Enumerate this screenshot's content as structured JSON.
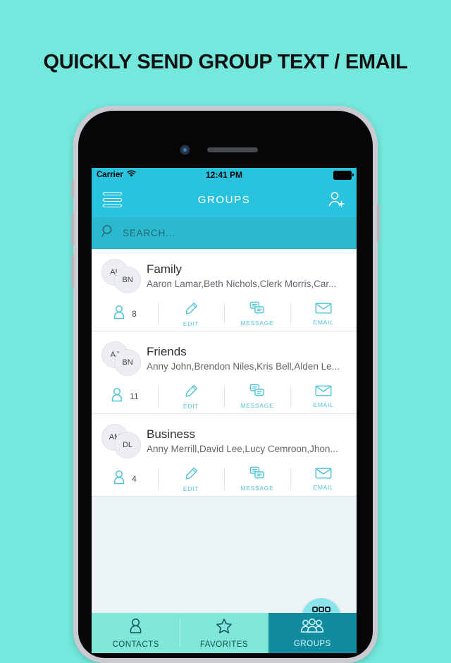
{
  "headline": "QUICKLY SEND GROUP TEXT / EMAIL",
  "colors": {
    "page_background": "#74e8dd",
    "nav_accent": "#2ac3dd",
    "search_background": "#2ab9cf",
    "action_icon": "#4fc3d9",
    "tab_inactive": "#7fe8d8",
    "tab_active": "#118b9e",
    "fab_background": "#8ee4ec",
    "screen_background": "#ecf4f6"
  },
  "status_bar": {
    "carrier": "Carrier",
    "wifi_icon": "wifi-icon",
    "time": "12:41 PM",
    "battery_icon": "battery-full-icon"
  },
  "nav": {
    "menu_icon": "hamburger-menu-icon",
    "title": "GROUPS",
    "add_icon": "add-person-icon"
  },
  "search": {
    "icon": "search-icon",
    "placeholder": "SEARCH..."
  },
  "groups": [
    {
      "name": "Family",
      "members": "Aaron Lamar,Beth Nichols,Clerk Morris,Car...",
      "avatar_1": "AL",
      "avatar_2": "BN",
      "count": "8",
      "actions": {
        "edit": "EDIT",
        "message": "MESSAGE",
        "email": "EMAIL"
      }
    },
    {
      "name": "Friends",
      "members": "Anny John,Brendon Niles,Kris Bell,Alden Le...",
      "avatar_1": "AJ",
      "avatar_2": "BN",
      "count": "11",
      "actions": {
        "edit": "EDIT",
        "message": "MESSAGE",
        "email": "EMAIL"
      }
    },
    {
      "name": "Business",
      "members": "Anny Merrill,David Lee,Lucy Cemroon,Jhon...",
      "avatar_1": "AM",
      "avatar_2": "DL",
      "count": "4",
      "actions": {
        "edit": "EDIT",
        "message": "MESSAGE",
        "email": "EMAIL"
      }
    }
  ],
  "fab": {
    "icon": "dialpad-icon"
  },
  "tabs": [
    {
      "label": "CONTACTS",
      "icon": "person-icon",
      "active": false
    },
    {
      "label": "FAVORITES",
      "icon": "star-icon",
      "active": false
    },
    {
      "label": "GROUPS",
      "icon": "group-people-icon",
      "active": true
    }
  ]
}
